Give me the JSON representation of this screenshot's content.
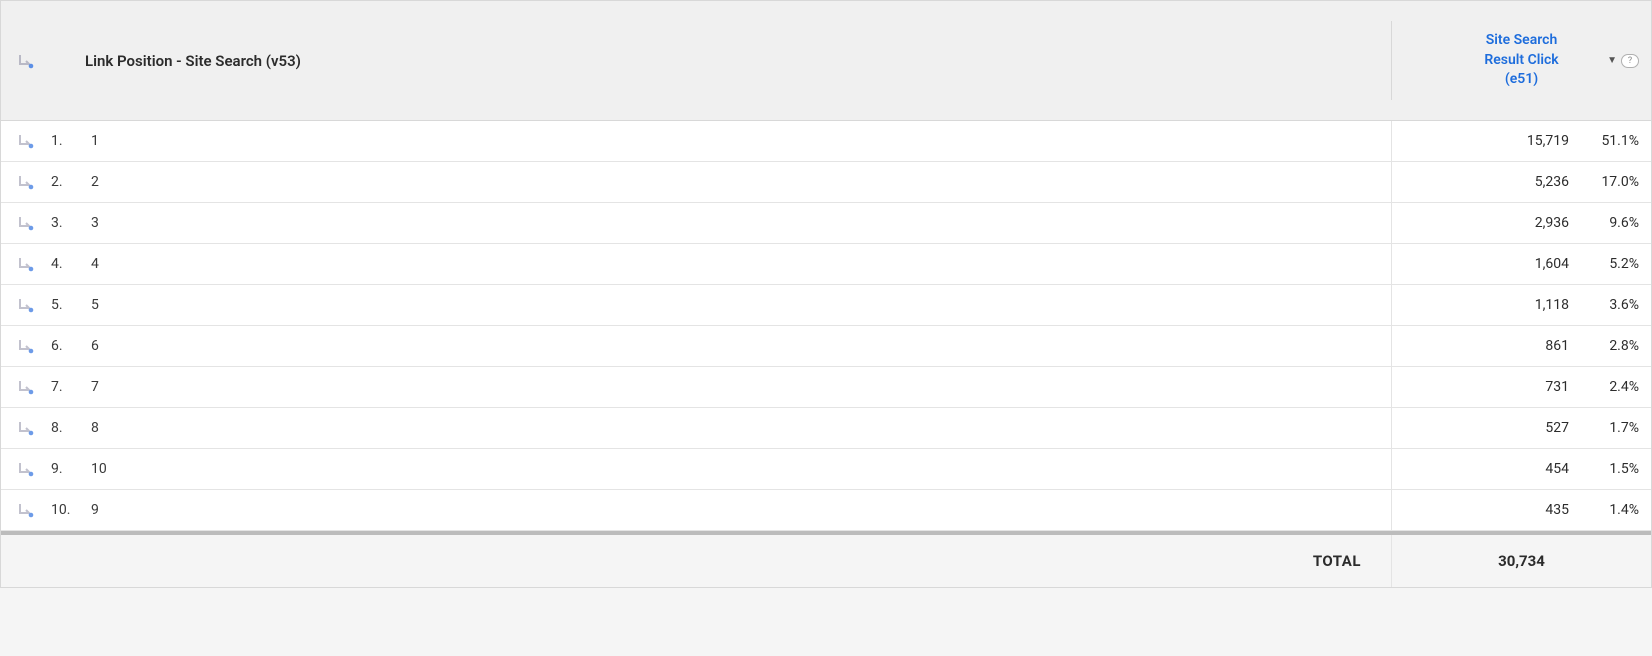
{
  "dimension_label": "Link Position - Site Search (v53)",
  "metric_label": "Site Search Result Click (e51)",
  "total_label": "TOTAL",
  "total_value": "30,734",
  "rows": [
    {
      "rank": "1.",
      "value": "1",
      "metric": "15,719",
      "pct": "51.1%"
    },
    {
      "rank": "2.",
      "value": "2",
      "metric": "5,236",
      "pct": "17.0%"
    },
    {
      "rank": "3.",
      "value": "3",
      "metric": "2,936",
      "pct": "9.6%"
    },
    {
      "rank": "4.",
      "value": "4",
      "metric": "1,604",
      "pct": "5.2%"
    },
    {
      "rank": "5.",
      "value": "5",
      "metric": "1,118",
      "pct": "3.6%"
    },
    {
      "rank": "6.",
      "value": "6",
      "metric": "861",
      "pct": "2.8%"
    },
    {
      "rank": "7.",
      "value": "7",
      "metric": "731",
      "pct": "2.4%"
    },
    {
      "rank": "8.",
      "value": "8",
      "metric": "527",
      "pct": "1.7%"
    },
    {
      "rank": "9.",
      "value": "10",
      "metric": "454",
      "pct": "1.5%"
    },
    {
      "rank": "10.",
      "value": "9",
      "metric": "435",
      "pct": "1.4%"
    }
  ]
}
